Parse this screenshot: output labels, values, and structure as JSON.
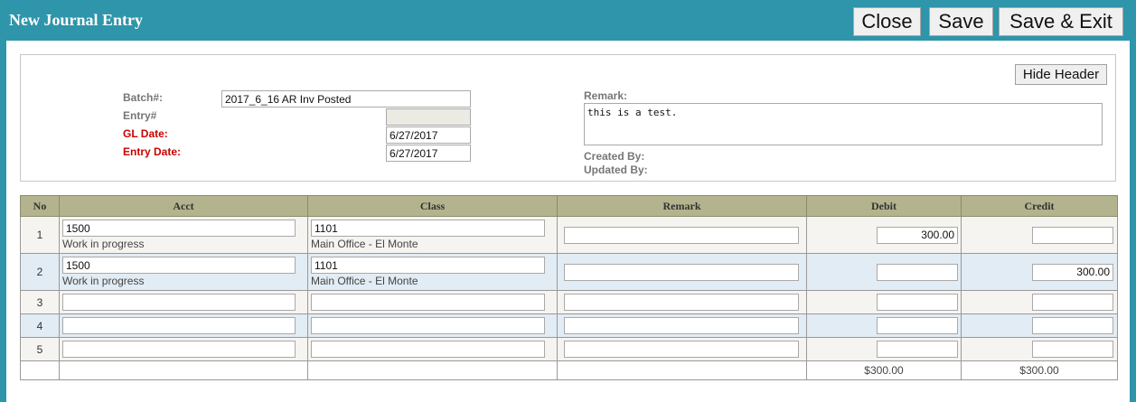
{
  "window": {
    "title": "New Journal Entry"
  },
  "toolbar": {
    "close_label": "Close",
    "save_label": "Save",
    "save_exit_label": "Save & Exit"
  },
  "header": {
    "hide_header_label": "Hide Header",
    "batch_label": "Batch#:",
    "batch_value": "2017_6_16 AR Inv Posted",
    "entry_label": "Entry#",
    "entry_value": "",
    "gl_date_label": "GL Date:",
    "gl_date_value": "6/27/2017",
    "entry_date_label": "Entry Date:",
    "entry_date_value": "6/27/2017",
    "remark_label": "Remark:",
    "remark_value": "this is a test.",
    "created_by_label": "Created By:",
    "updated_by_label": "Updated By:"
  },
  "grid": {
    "columns": [
      "No",
      "Acct",
      "Class",
      "Remark",
      "Debit",
      "Credit"
    ],
    "rows": [
      {
        "no": "1",
        "acct": "1500",
        "acct_desc": "Work in progress",
        "class": "1101",
        "class_desc": "Main Office - El Monte",
        "remark": "",
        "debit": "300.00",
        "credit": ""
      },
      {
        "no": "2",
        "acct": "1500",
        "acct_desc": "Work in progress",
        "class": "1101",
        "class_desc": "Main Office - El Monte",
        "remark": "",
        "debit": "",
        "credit": "300.00"
      },
      {
        "no": "3",
        "acct": "",
        "acct_desc": "",
        "class": "",
        "class_desc": "",
        "remark": "",
        "debit": "",
        "credit": ""
      },
      {
        "no": "4",
        "acct": "",
        "acct_desc": "",
        "class": "",
        "class_desc": "",
        "remark": "",
        "debit": "",
        "credit": ""
      },
      {
        "no": "5",
        "acct": "",
        "acct_desc": "",
        "class": "",
        "class_desc": "",
        "remark": "",
        "debit": "",
        "credit": ""
      }
    ],
    "total_debit": "$300.00",
    "total_credit": "$300.00"
  },
  "colors": {
    "topbar": "#2e95aa",
    "grid_header": "#b3b38e",
    "required_label": "#cc0000"
  }
}
